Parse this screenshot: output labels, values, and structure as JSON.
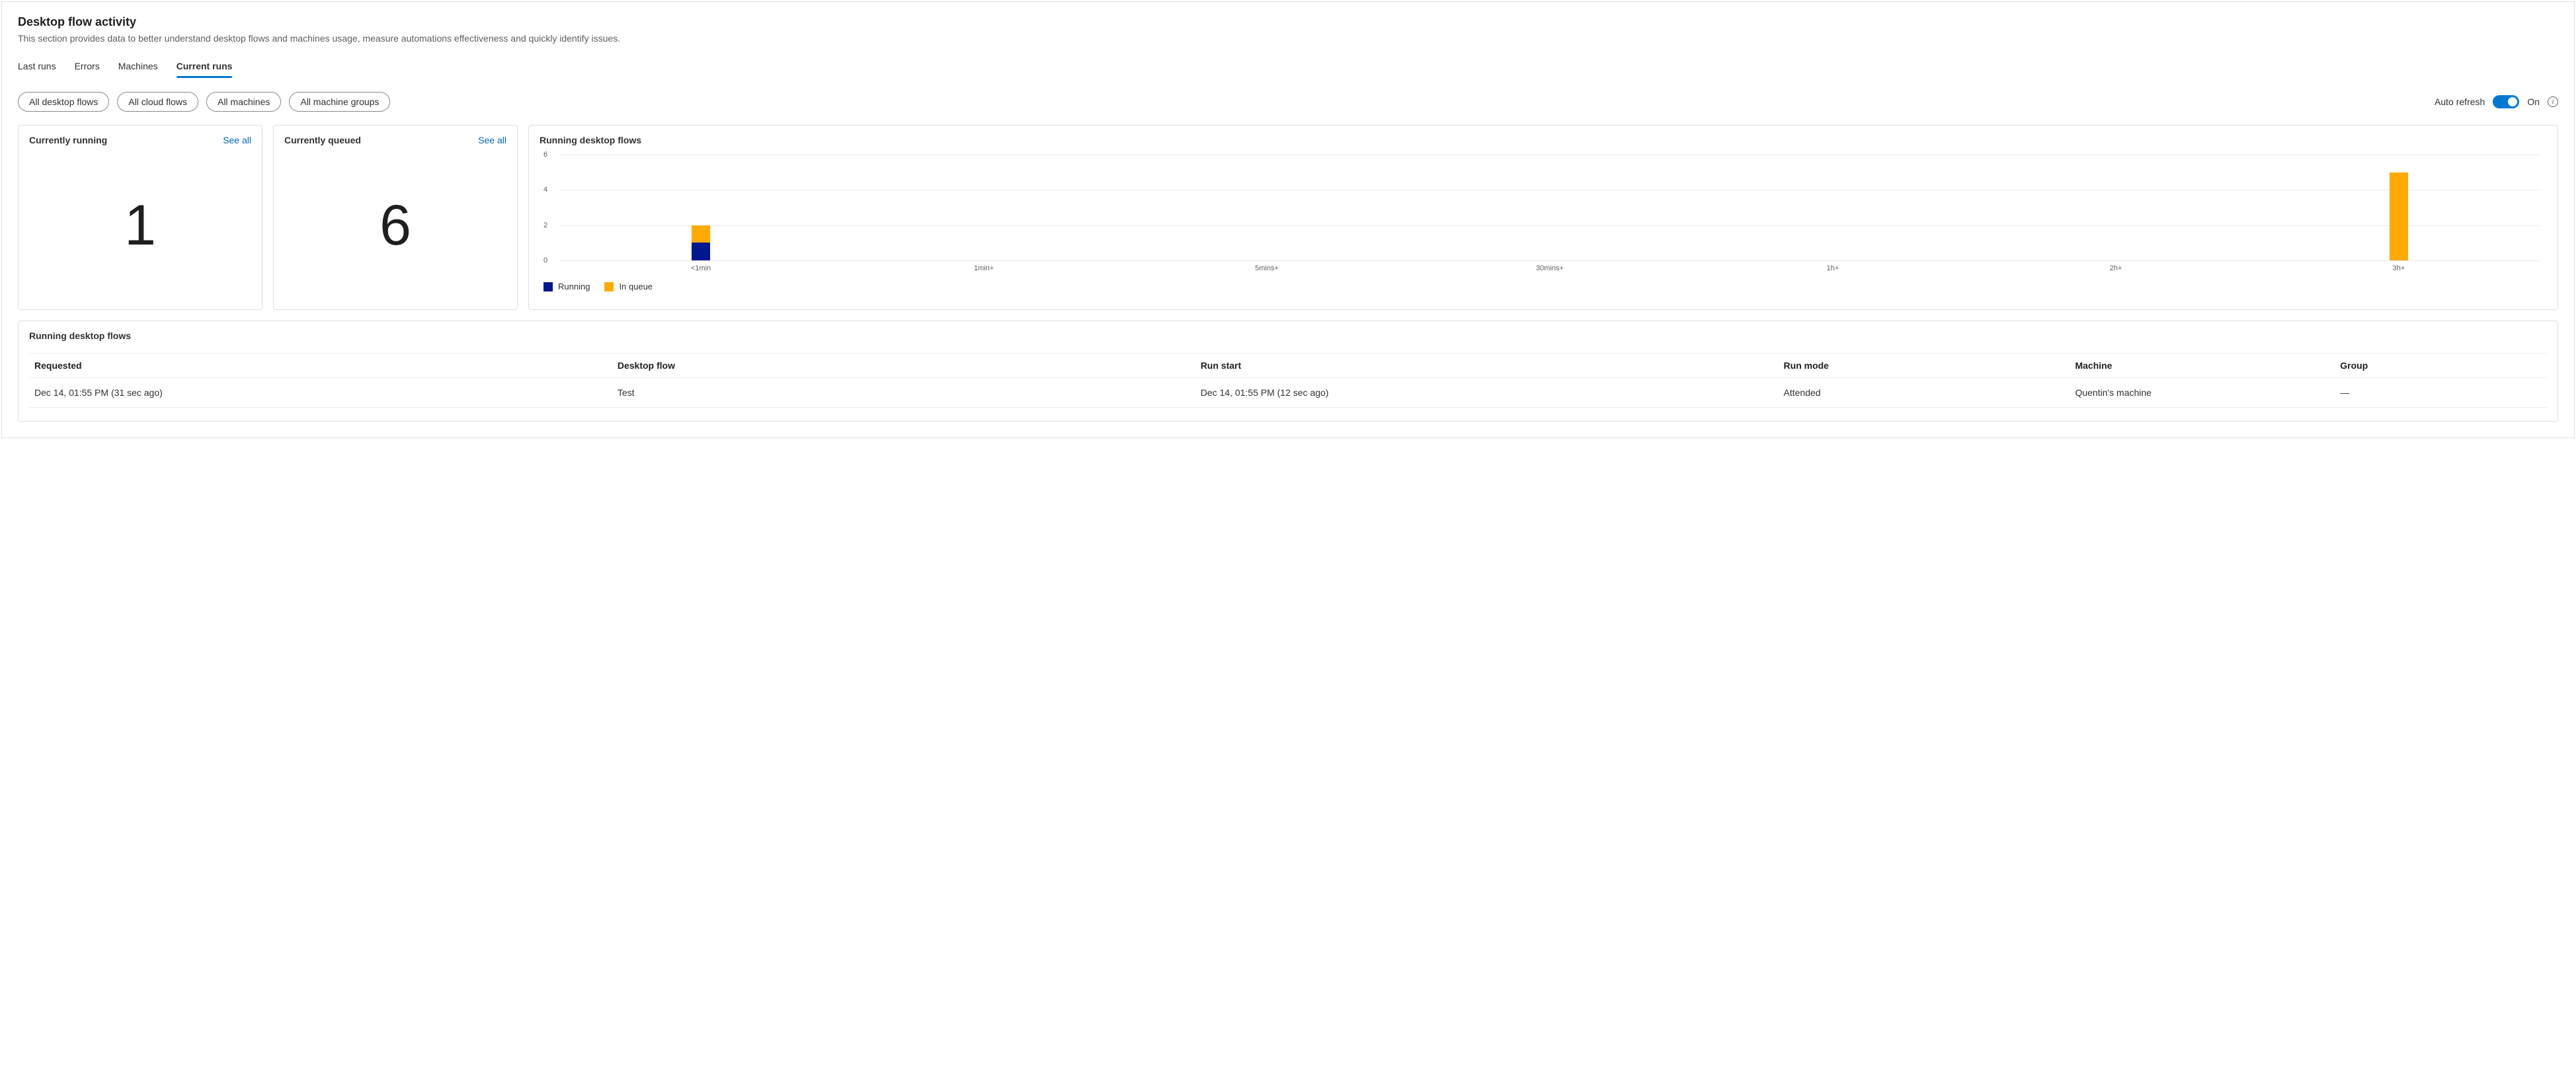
{
  "header": {
    "title": "Desktop flow activity",
    "description": "This section provides data to better understand desktop flows and machines usage, measure automations effectiveness and quickly identify issues."
  },
  "tabs": [
    {
      "label": "Last runs",
      "active": false
    },
    {
      "label": "Errors",
      "active": false
    },
    {
      "label": "Machines",
      "active": false
    },
    {
      "label": "Current runs",
      "active": true
    }
  ],
  "filters": [
    "All desktop flows",
    "All cloud flows",
    "All machines",
    "All machine groups"
  ],
  "auto_refresh": {
    "label": "Auto refresh",
    "state": "On"
  },
  "cards": {
    "currently_running": {
      "title": "Currently running",
      "see_all": "See all",
      "value": "1"
    },
    "currently_queued": {
      "title": "Currently queued",
      "see_all": "See all",
      "value": "6"
    },
    "chart_title": "Running desktop flows"
  },
  "chart_data": {
    "type": "bar",
    "categories": [
      "<1min",
      "1min+",
      "5mins+",
      "30mins+",
      "1h+",
      "2h+",
      "3h+"
    ],
    "series": [
      {
        "name": "Running",
        "values": [
          1,
          0,
          0,
          0,
          0,
          0,
          0
        ]
      },
      {
        "name": "In queue",
        "values": [
          1,
          0,
          0,
          0,
          0,
          0,
          5
        ]
      }
    ],
    "ylim": [
      0,
      6
    ],
    "y_ticks": [
      0,
      2,
      4,
      6
    ],
    "colors": {
      "Running": "#00188f",
      "In queue": "#ffaa00"
    }
  },
  "table": {
    "title": "Running desktop flows",
    "columns": [
      "Requested",
      "Desktop flow",
      "Run start",
      "Run mode",
      "Machine",
      "Group"
    ],
    "rows": [
      {
        "requested": "Dec 14, 01:55 PM (31 sec ago)",
        "desktop_flow": "Test",
        "run_start": "Dec 14, 01:55 PM (12 sec ago)",
        "run_mode": "Attended",
        "machine": "Quentin's machine",
        "group": "—"
      }
    ]
  }
}
